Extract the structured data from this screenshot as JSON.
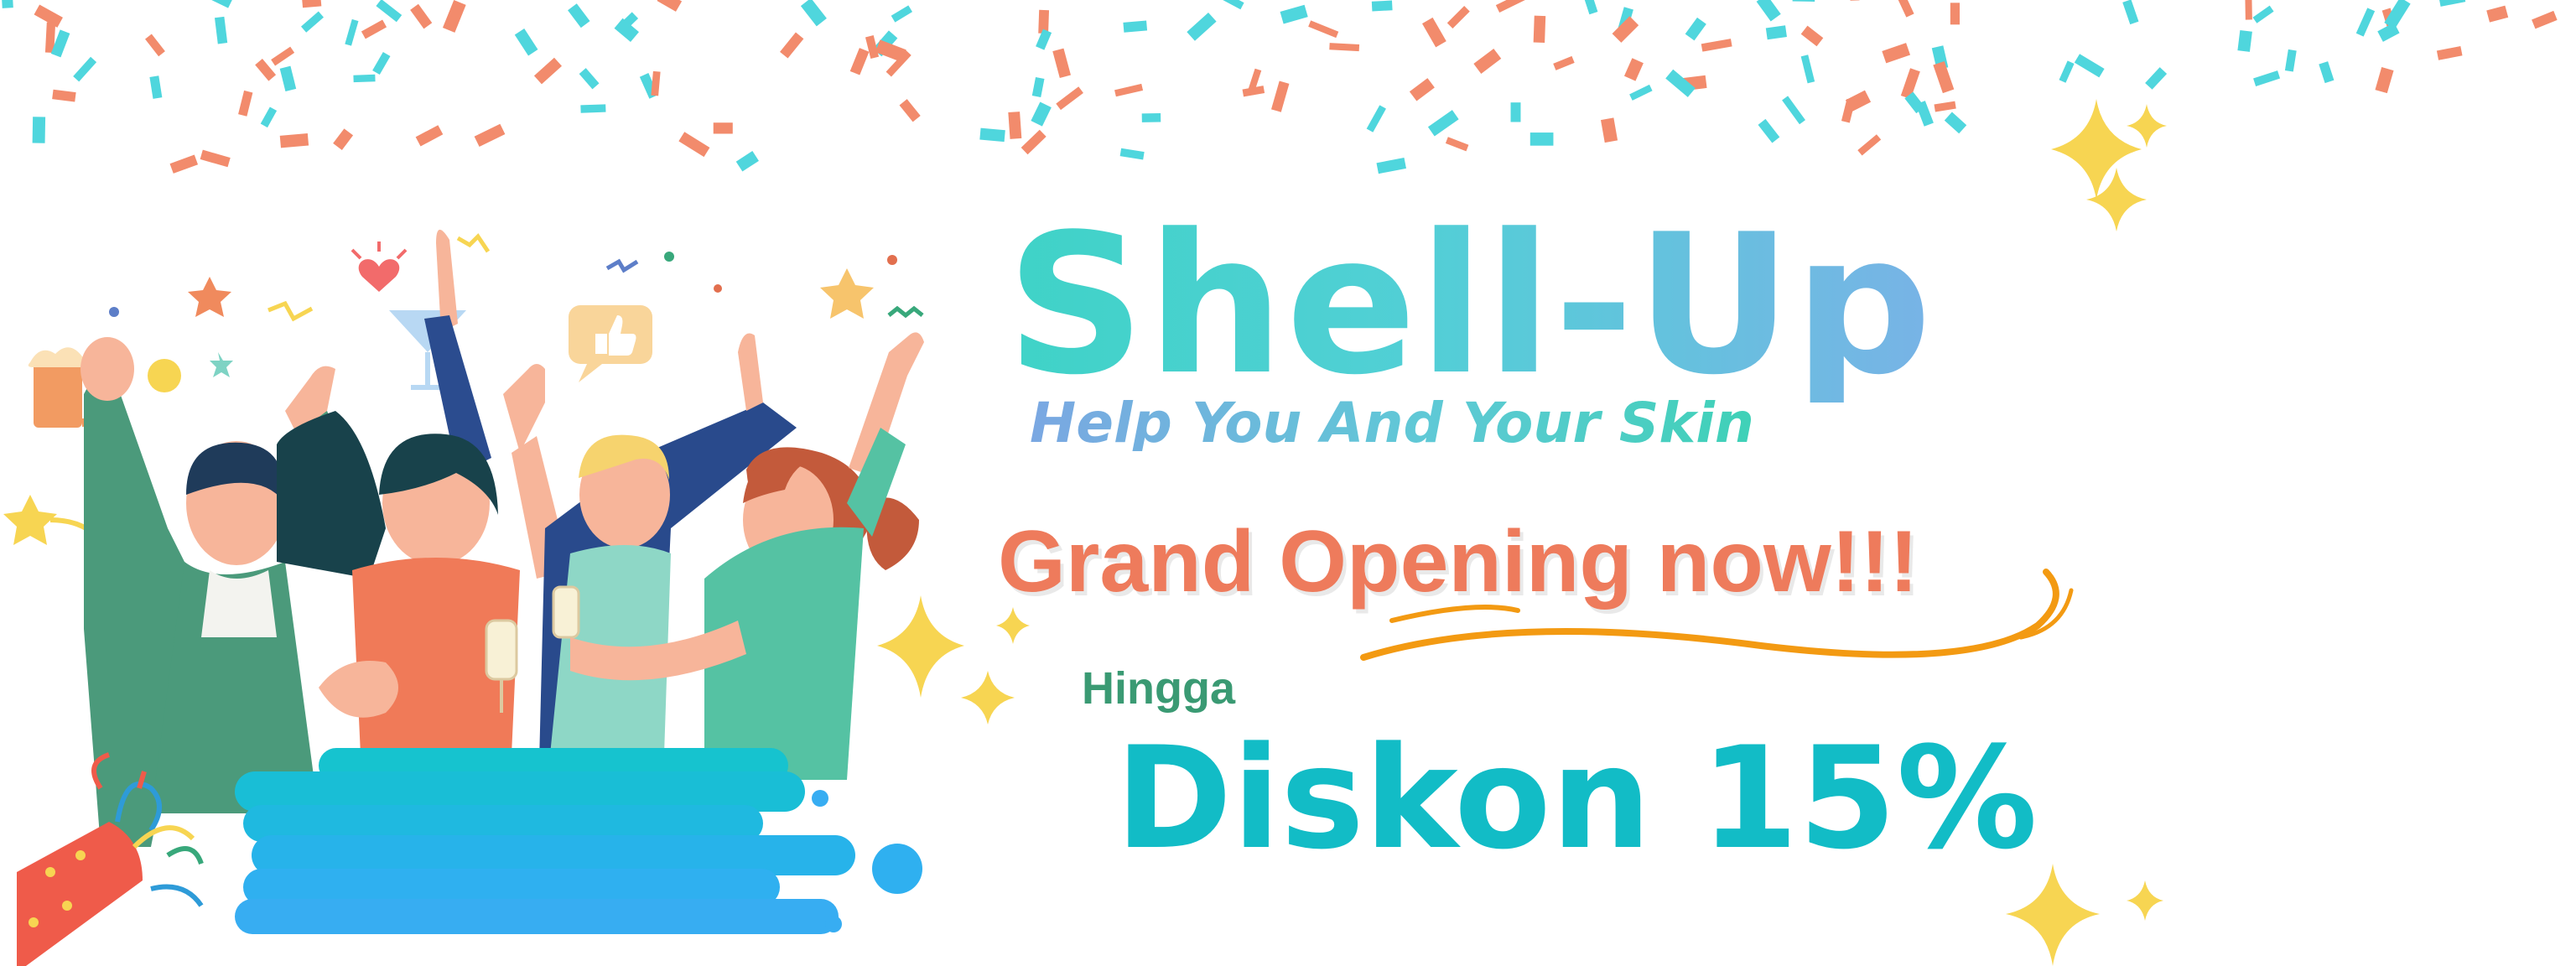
{
  "brand": {
    "name": "Shell-Up",
    "tagline": "Help You And Your Skin"
  },
  "promo": {
    "headline": "Grand Opening now!!!",
    "prefix": "Hingga",
    "discount": "Diskon 15%"
  },
  "colors": {
    "brand_gradient_start": "#3fd3c7",
    "brand_gradient_end": "#78b3e6",
    "headline": "#ee7b5c",
    "prefix": "#3a9a73",
    "discount": "#12bcc6",
    "swoosh": "#f39a12",
    "sparkle": "#f7d552",
    "confetti_coral": "#f28b6c",
    "confetti_teal": "#4fd6dd",
    "paint_blue": "#22b6ec"
  },
  "decor": {
    "illustration": "celebrating-people-illustration",
    "icons": [
      "confetti",
      "sparkle-icon",
      "party-popper-icon",
      "beer-mug-icon",
      "cocktail-glass-icon",
      "thumbs-up-icon",
      "heart-icon",
      "star-icon"
    ]
  }
}
